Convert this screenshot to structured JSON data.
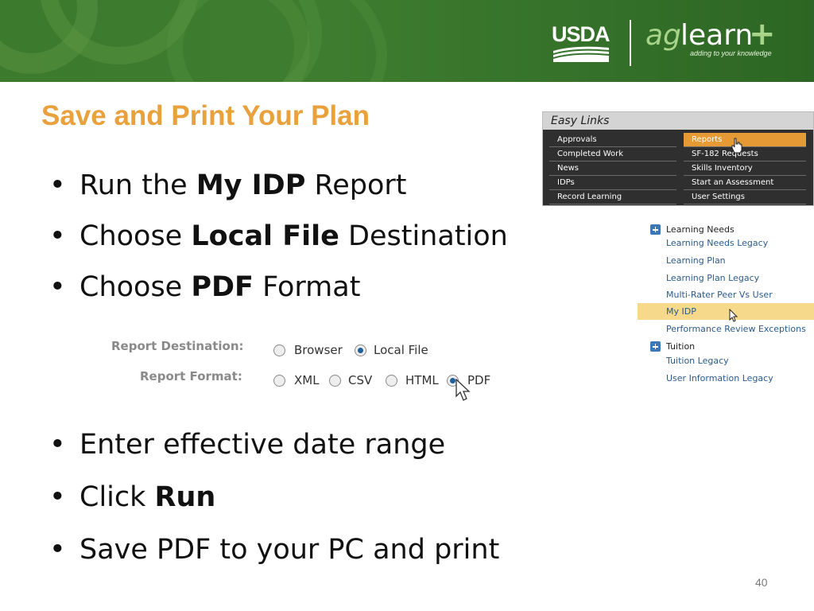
{
  "header": {
    "usda_logo": "USDA",
    "aglearn_logo_ag": "ag",
    "aglearn_logo_learn": "learn",
    "aglearn_logo_plus": "+",
    "aglearn_tagline": "adding to your knowledge"
  },
  "slide": {
    "title": "Save and Print Your Plan",
    "bullet_glyph": "•",
    "bullets_top": [
      {
        "pre": "Run the ",
        "bold": "My IDP",
        "post": " Report"
      },
      {
        "pre": "Choose ",
        "bold": "Local File",
        "post": " Destination"
      },
      {
        "pre": "Choose ",
        "bold": "PDF",
        "post": " Format"
      }
    ],
    "bullets_bottom": [
      {
        "pre": "Enter effective date range",
        "bold": "",
        "post": ""
      },
      {
        "pre": "Click ",
        "bold": "Run",
        "post": ""
      },
      {
        "pre": "Save PDF to your PC and print",
        "bold": "",
        "post": ""
      }
    ],
    "page_number": "40"
  },
  "report_form": {
    "destination_label": "Report Destination:",
    "format_label": "Report Format:",
    "destination_options": [
      {
        "label": "Browser",
        "checked": false
      },
      {
        "label": "Local File",
        "checked": true
      }
    ],
    "format_options": [
      {
        "label": "XML",
        "checked": false
      },
      {
        "label": "CSV",
        "checked": false
      },
      {
        "label": "HTML",
        "checked": false
      },
      {
        "label": "PDF",
        "checked": true
      }
    ]
  },
  "easy_links": {
    "title": "Easy Links",
    "left_column": [
      "Approvals",
      "Completed Work",
      "News",
      "IDPs",
      "Record Learning"
    ],
    "right_column": [
      "Reports",
      "SF-182 Requests",
      "Skills Inventory",
      "Start an Assessment",
      "User Settings"
    ],
    "active_item": "Reports"
  },
  "report_list": {
    "items": [
      {
        "label": "Learning Needs",
        "group": true,
        "highlight": false
      },
      {
        "label": "Learning Needs Legacy",
        "group": false,
        "highlight": false
      },
      {
        "label": "Learning Plan",
        "group": false,
        "highlight": false
      },
      {
        "label": "Learning Plan Legacy",
        "group": false,
        "highlight": false
      },
      {
        "label": "Multi-Rater Peer Vs User",
        "group": false,
        "highlight": false
      },
      {
        "label": "My IDP",
        "group": false,
        "highlight": true
      },
      {
        "label": "Performance Review Exceptions",
        "group": false,
        "highlight": false
      },
      {
        "label": "Tuition",
        "group": true,
        "highlight": false
      },
      {
        "label": "Tuition Legacy",
        "group": false,
        "highlight": false
      },
      {
        "label": "User Information Legacy",
        "group": false,
        "highlight": false
      }
    ]
  }
}
